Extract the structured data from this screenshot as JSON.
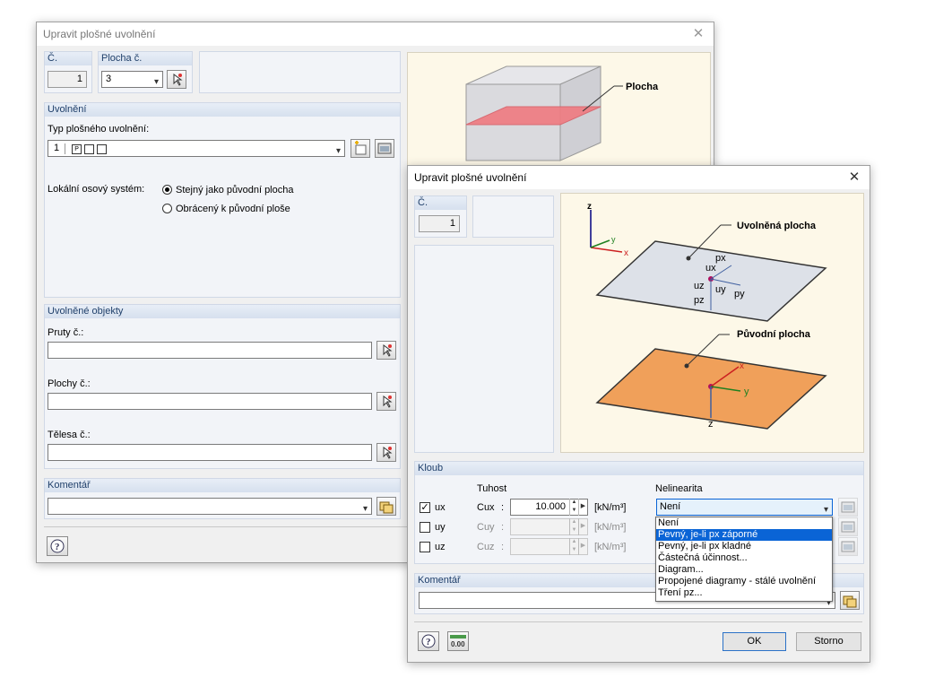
{
  "back": {
    "title": "Upravit plošné uvolnění",
    "no_label": "Č.",
    "no_value": "1",
    "surface_label": "Plocha č.",
    "surface_value": "3",
    "release_group": "Uvolnění",
    "type_label": "Typ plošného uvolnění:",
    "type_value": "1",
    "axes_label": "Lokální osový systém:",
    "radio_same": "Stejný jako původní plocha",
    "radio_reversed": "Obrácený k původní ploše",
    "objects_group": "Uvolněné objekty",
    "members_label": "Pruty č.:",
    "surfaces_label": "Plochy č.:",
    "solids_label": "Tělesa č.:",
    "comment_group": "Komentář",
    "image_label": "Plocha"
  },
  "front": {
    "title": "Upravit plošné uvolnění",
    "no_label": "Č.",
    "no_value": "1",
    "image": {
      "released_label": "Uvolněná plocha",
      "original_label": "Původní plocha",
      "z": "z",
      "y": "y",
      "x": "x",
      "px": "px",
      "ux": "ux",
      "uz": "uz",
      "uy": "uy",
      "py": "py",
      "pz": "pz"
    },
    "hinge_group": "Kloub",
    "stiffness_header": "Tuhost",
    "nonlinearity_header": "Nelinearita",
    "rows": [
      {
        "dof": "ux",
        "c": "Cux",
        "colon": ":",
        "value": "10.000",
        "unit": "[kN/m³]",
        "checked": true
      },
      {
        "dof": "uy",
        "c": "Cuy",
        "colon": ":",
        "value": "",
        "unit": "[kN/m³]",
        "checked": false
      },
      {
        "dof": "uz",
        "c": "Cuz",
        "colon": ":",
        "value": "",
        "unit": "[kN/m³]",
        "checked": false
      }
    ],
    "nonlinearity_value": "Není",
    "dropdown_items": [
      "Není",
      "Pevný, je-li px záporné",
      "Pevný, je-li px kladné",
      "Částečná účinnost...",
      "Diagram...",
      "Propojené diagramy - stálé uvolnění",
      "Tření pz..."
    ],
    "dropdown_selected": 1,
    "comment_group": "Komentář",
    "units_icon_text": "0.00",
    "ok": "OK",
    "cancel": "Storno"
  },
  "colors": {
    "accent": "#0a64d6",
    "group_header": "#d6e0ee",
    "released_surface": "#dde1e8",
    "original_surface": "#f0a05a",
    "release_plane": "#f07a80"
  }
}
